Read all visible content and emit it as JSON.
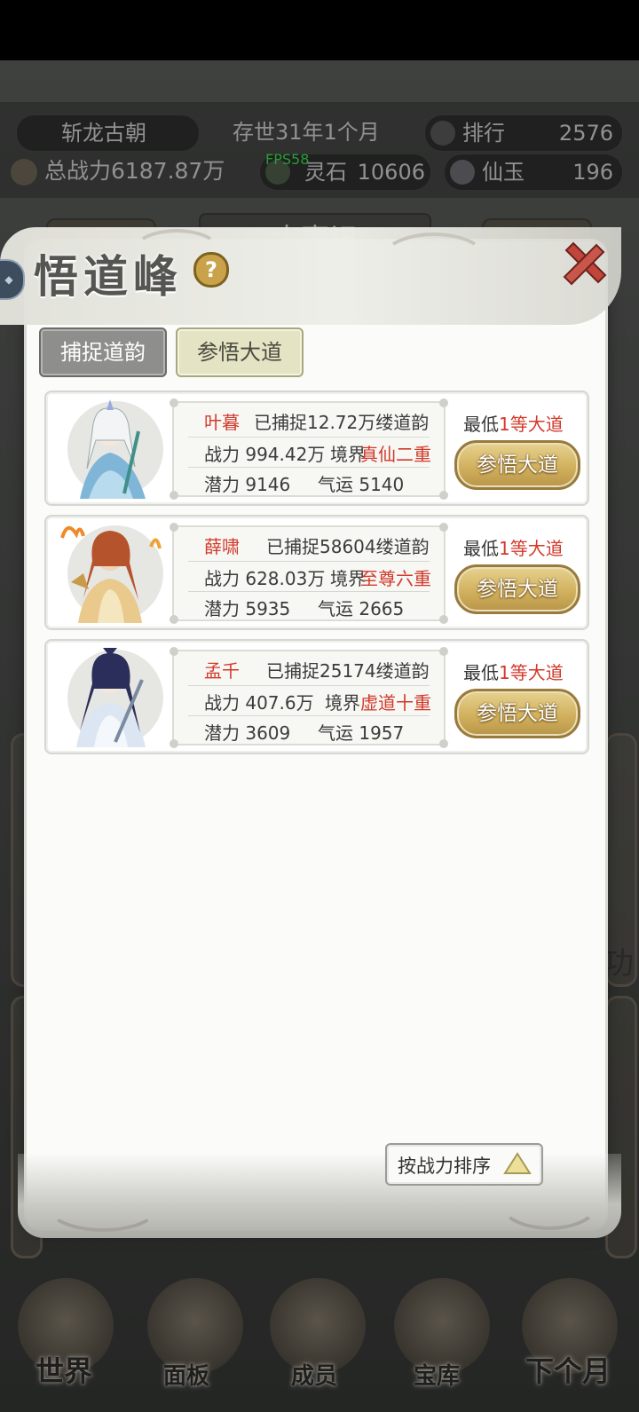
{
  "header": {
    "dynasty": "斩龙古朝",
    "age": "存世31年1个月",
    "rank_label": "排行",
    "rank_value": "2576",
    "power": "总战力6187.87万",
    "spirit_stone_label": "灵石",
    "spirit_stone_value": "10606",
    "jade_label": "仙玉",
    "jade_value": "196",
    "fps": "FPS58"
  },
  "background": {
    "tab_label": "大事记",
    "side_char": "功"
  },
  "modal": {
    "title": "悟道峰",
    "help_icon": "?",
    "tabs": [
      {
        "label": "捕捉道韵",
        "active": false
      },
      {
        "label": "参悟大道",
        "active": true
      }
    ],
    "cards": [
      {
        "name": "叶暮",
        "captured": "已捕捉12.72万缕道韵",
        "power": "战力 994.42万",
        "realm_label": "境界",
        "realm": "真仙二重",
        "potential": "潜力 9146",
        "luck": "气运 5140",
        "req_prefix": "最低",
        "req_value": "1等大道",
        "button": "参悟大道"
      },
      {
        "name": "薛啸",
        "captured": "已捕捉58604缕道韵",
        "power": "战力 628.03万",
        "realm_label": "境界",
        "realm": "至尊六重",
        "potential": "潜力 5935",
        "luck": "气运 2665",
        "req_prefix": "最低",
        "req_value": "1等大道",
        "button": "参悟大道"
      },
      {
        "name": "孟千",
        "captured": "已捕捉25174缕道韵",
        "power": "战力 407.6万",
        "realm_label": "境界",
        "realm": "虚道十重",
        "potential": "潜力 3609",
        "luck": "气运 1957",
        "req_prefix": "最低",
        "req_value": "1等大道",
        "button": "参悟大道"
      }
    ],
    "sort_button": "按战力排序"
  },
  "dock": {
    "items": [
      "世界",
      "面板",
      "成员",
      "宝库",
      "下个月"
    ]
  },
  "colors": {
    "accent_red": "#d23a2b",
    "button_gold": "#cfae5a",
    "fps_green": "#3bd64b"
  }
}
